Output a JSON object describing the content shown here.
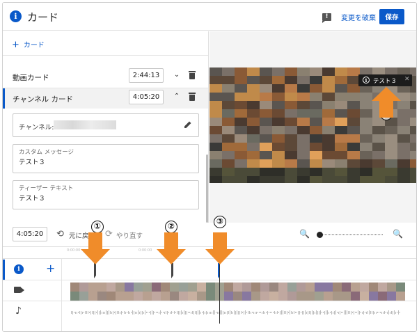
{
  "header": {
    "title": "カード",
    "discard_label": "変更を破棄",
    "save_label": "保存",
    "info_glyph": "i",
    "feedback_glyph": "!"
  },
  "sidebar": {
    "add_card_label": "カード",
    "add_card_glyph": "+",
    "cards": [
      {
        "label": "動画カード",
        "time": "2:44:13",
        "chevron": "⌄"
      },
      {
        "label": "チャンネル カード",
        "time": "4:05:20",
        "chevron": "⌃"
      }
    ],
    "detail": {
      "channel_label": "チャンネル:",
      "custom_message_label": "カスタム メッセージ",
      "custom_message_value": "テスト３",
      "teaser_label": "ティーザー テキスト",
      "teaser_value": "テスト３"
    }
  },
  "preview": {
    "teaser_text": "テスト３",
    "teaser_close": "✕",
    "teaser_info_glyph": "i"
  },
  "toolbar": {
    "current_time": "4:05:20",
    "undo_label": "元に戻す",
    "redo_label": "やり直す",
    "undo_glyph": "⟲",
    "redo_glyph": "⟳",
    "zoom_out_glyph": "🔍",
    "zoom_in_glyph": "🔍",
    "zoom_level": 0.0
  },
  "timeline": {
    "tracks": [
      "cards",
      "video",
      "audio"
    ],
    "card_plus_glyph": "+",
    "audio_glyph": "♪",
    "ruler_labels": [
      "0:00:00",
      "0:00:00",
      "0:00:00"
    ]
  },
  "annotations": {
    "callouts": [
      "①",
      "②",
      "③",
      "③"
    ]
  },
  "colors": {
    "accent": "#0a59c9",
    "annotation_orange": "#f08c2a"
  }
}
